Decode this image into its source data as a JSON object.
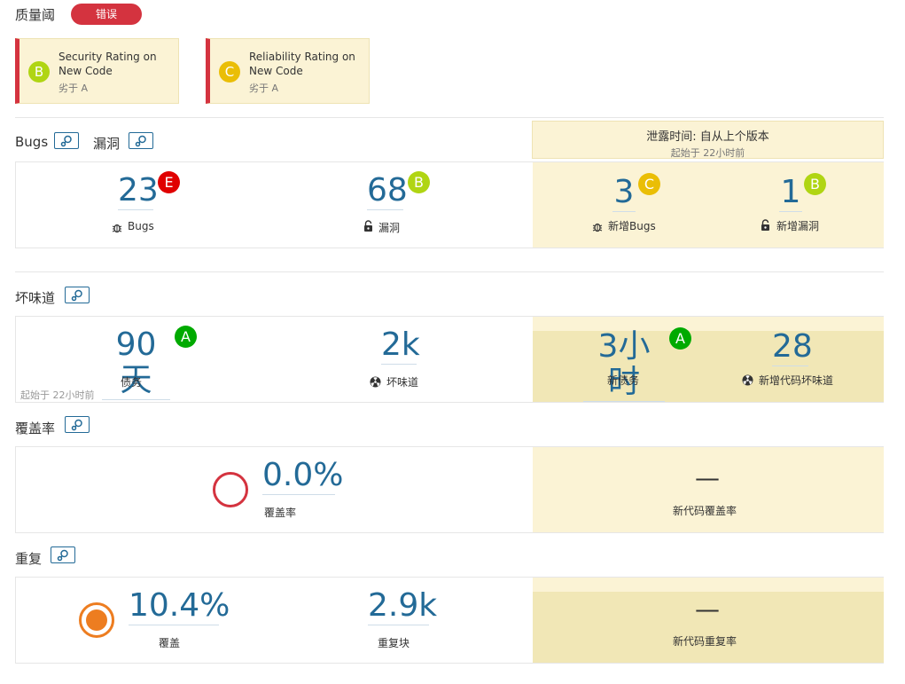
{
  "quality_gate": {
    "title": "质量阈",
    "status": "错误"
  },
  "conditions": [
    {
      "rating": "B",
      "text": "Security Rating on New Code",
      "sub": "劣于 A",
      "color": "#b0d513"
    },
    {
      "rating": "C",
      "text": "Reliability Rating on New Code",
      "sub": "劣于 A",
      "color": "#eabe06"
    }
  ],
  "colors": {
    "error": "#d4333f",
    "link": "#236a97",
    "rating_a": "#00aa00",
    "rating_b": "#b0d513",
    "rating_c": "#eabe06",
    "rating_e": "#e00000",
    "coverage_ring": "#d4333f",
    "dup_ring": "#ed7d20"
  },
  "leak_period": {
    "title": "泄露时间: 自从上个版本",
    "since": "起始于 22小时前"
  },
  "bugs_section": {
    "title_bugs": "Bugs",
    "title_vuln": "漏洞",
    "bugs": {
      "value": "23",
      "rating": "E",
      "label": "Bugs"
    },
    "vulnerabilities": {
      "value": "68",
      "rating": "B",
      "label": "漏洞"
    },
    "new_bugs": {
      "value": "3",
      "rating": "C",
      "label": "新增Bugs"
    },
    "new_vulnerabilities": {
      "value": "1",
      "rating": "B",
      "label": "新增漏洞"
    }
  },
  "code_smells_section": {
    "title": "坏味道",
    "debt": {
      "value": "90天",
      "rating": "A",
      "label": "债务"
    },
    "smells": {
      "value": "2k",
      "label": "坏味道"
    },
    "since": "起始于 22小时前",
    "new_debt": {
      "value": "3小时",
      "rating": "A",
      "label": "新债务"
    },
    "new_smells": {
      "value": "28",
      "label": "新增代码坏味道"
    }
  },
  "coverage_section": {
    "title": "覆盖率",
    "coverage": {
      "value": "0.0%",
      "label": "覆盖率"
    },
    "new_coverage": {
      "value": "—",
      "label": "新代码覆盖率"
    }
  },
  "duplications_section": {
    "title": "重复",
    "duplication": {
      "value": "10.4%",
      "label": "覆盖"
    },
    "blocks": {
      "value": "2.9k",
      "label": "重复块"
    },
    "new_duplication": {
      "value": "—",
      "label": "新代码重复率"
    }
  }
}
